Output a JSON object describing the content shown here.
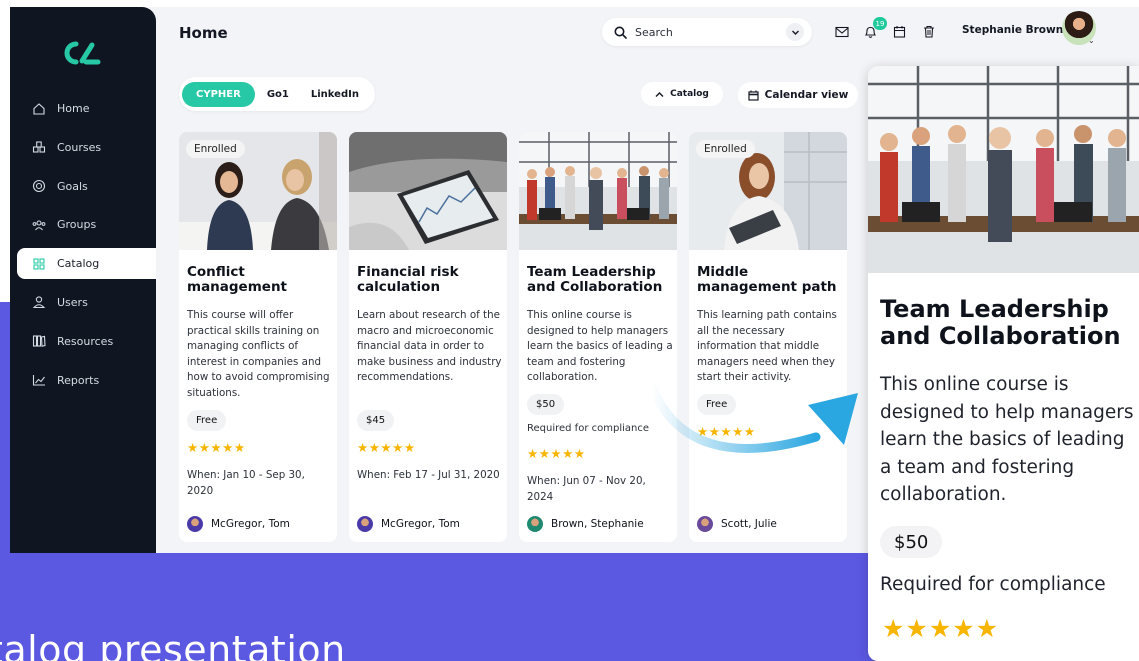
{
  "app": {
    "page_title": "Home",
    "logo_icon": "brand-logo"
  },
  "sidebar": {
    "items": [
      {
        "label": "Home",
        "icon": "home-icon"
      },
      {
        "label": "Courses",
        "icon": "courses-icon"
      },
      {
        "label": "Goals",
        "icon": "goals-icon"
      },
      {
        "label": "Groups",
        "icon": "groups-icon"
      },
      {
        "label": "Catalog",
        "icon": "catalog-icon",
        "active": true
      },
      {
        "label": "Users",
        "icon": "user-icon"
      },
      {
        "label": "Resources",
        "icon": "resources-icon"
      },
      {
        "label": "Reports",
        "icon": "reports-icon"
      }
    ]
  },
  "header": {
    "search_placeholder": "Search",
    "notification_count": "19",
    "user_name": "Stephanie Brown"
  },
  "tabs": [
    "CYPHER",
    "Go1",
    "LinkedIn"
  ],
  "toolbar": {
    "catalog_label": "Catalog",
    "calendar_label": "Calendar view"
  },
  "cards": [
    {
      "badge": "Enrolled",
      "title": "Conflict management",
      "description": "This course will offer practical skills training on managing conflicts of interest in companies and how to avoid compromising situations.",
      "price": "Free",
      "stars": "★★★★★",
      "when": "When: Jan 10 - Sep 30, 2020",
      "author": "McGregor, Tom"
    },
    {
      "badge": "",
      "title": "Financial risk calculation",
      "description": "Learn about research of the macro and microeconomic financial data in order to make business and industry recommendations.",
      "price": "$45",
      "stars": "★★★★★",
      "when": "When: Feb 17 - Jul 31, 2020",
      "author": "McGregor, Tom"
    },
    {
      "badge": "",
      "title": "Team Leadership and Collaboration",
      "description": "This online course is designed to help managers learn the basics of leading a team and fostering collaboration.",
      "price": "$50",
      "compliance": "Required for compliance",
      "stars": "★★★★★",
      "when": "When: Jun 07 - Nov 20, 2024",
      "author": "Brown, Stephanie"
    },
    {
      "badge": "Enrolled",
      "title": "Middle management path",
      "description": "This learning path contains all the necessary information that middle managers need when they start their activity.",
      "price": "Free",
      "stars": "★★★★★",
      "author": "Scott, Julie"
    }
  ],
  "zoom_card": {
    "title": "Team Leadership and Collaboration",
    "description": "This online course is designed to help managers learn the basics of leading a team and fostering collaboration.",
    "price": "$50",
    "compliance": "Required for compliance",
    "stars": "★★★★★"
  },
  "caption": "talog presentation",
  "colors": {
    "accent": "#27c8a5",
    "sidebar": "#0f1521",
    "backdrop": "#5b58e2",
    "star": "#f7b500",
    "arrow": "#2aa6e0"
  }
}
